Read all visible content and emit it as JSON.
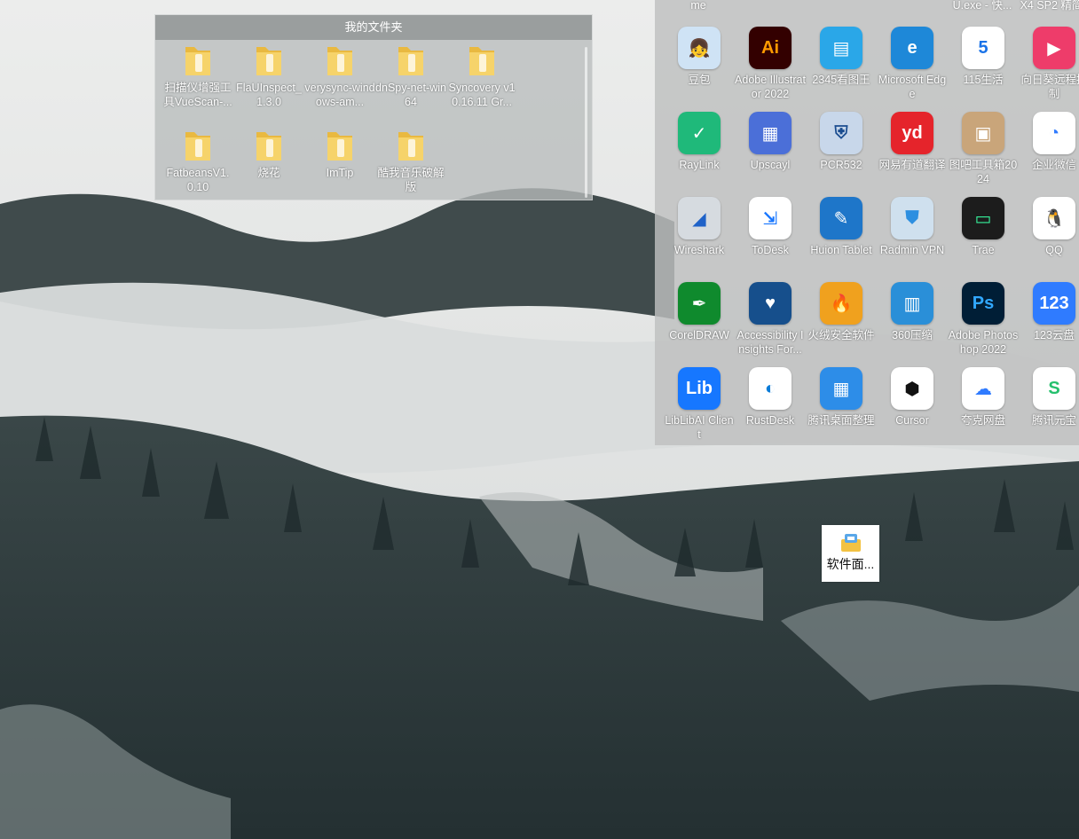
{
  "folder_window": {
    "title": "我的文件夹",
    "items": [
      {
        "label": "扫描仪增强工具VueScan-...",
        "icon": "folder-icon"
      },
      {
        "label": "FlaUInspect_1.3.0",
        "icon": "folder-icon"
      },
      {
        "label": "verysync-windows-am...",
        "icon": "folder-icon"
      },
      {
        "label": "dnSpy-net-win64",
        "icon": "folder-icon"
      },
      {
        "label": "Syncovery v10.16.11 Gr...",
        "icon": "folder-icon"
      },
      {
        "label": "FatbeansV1.0.10",
        "icon": "folder-icon"
      },
      {
        "label": "烧花",
        "icon": "folder-icon"
      },
      {
        "label": "ImTip",
        "icon": "folder-icon"
      },
      {
        "label": "酷我音乐破解版",
        "icon": "folder-icon"
      }
    ]
  },
  "apps_panel": {
    "top_partial_labels": [
      "me",
      "U.exe - 快...",
      "X4 SP2 精简"
    ],
    "apps": [
      {
        "label": "豆包",
        "icon": "doubao-icon",
        "bg": "#cfe3f5",
        "glyph": "👧"
      },
      {
        "label": "Adobe Illustrator 2022",
        "icon": "illustrator-icon",
        "bg": "#330000",
        "glyph": "Ai",
        "fg": "#ff9a00"
      },
      {
        "label": "2345看图王",
        "icon": "2345-viewer-icon",
        "bg": "#2aa7e8",
        "glyph": "▤"
      },
      {
        "label": "Microsoft Edge",
        "icon": "edge-icon",
        "bg": "#1e88d8",
        "glyph": "e"
      },
      {
        "label": "115生活",
        "icon": "115-icon",
        "bg": "#ffffff",
        "glyph": "5",
        "fg": "#1a73e8"
      },
      {
        "label": "向日葵远程控制",
        "icon": "sunlogin-icon",
        "bg": "#ee3c6a",
        "glyph": "▶"
      },
      {
        "label": "RayLink",
        "icon": "raylink-icon",
        "bg": "#1fb97a",
        "glyph": "✓"
      },
      {
        "label": "Upscayl",
        "icon": "upscayl-icon",
        "bg": "#4b6fd8",
        "glyph": "▦"
      },
      {
        "label": "PCR532",
        "icon": "pcr532-icon",
        "bg": "#c8d7ea",
        "glyph": "⛨",
        "fg": "#1a4c8f"
      },
      {
        "label": "网易有道翻译",
        "icon": "youdao-icon",
        "bg": "#e5242b",
        "glyph": "yd"
      },
      {
        "label": "图吧工具箱2024",
        "icon": "tuba-icon",
        "bg": "#c9a57a",
        "glyph": "▣"
      },
      {
        "label": "企业微信",
        "icon": "wecom-icon",
        "bg": "#ffffff",
        "glyph": "◔",
        "fg": "#2f7bff"
      },
      {
        "label": "Wireshark",
        "icon": "wireshark-icon",
        "bg": "#d6dbe0",
        "glyph": "◢",
        "fg": "#1f62c8"
      },
      {
        "label": "ToDesk",
        "icon": "todesk-icon",
        "bg": "#ffffff",
        "glyph": "⇲",
        "fg": "#1977ff"
      },
      {
        "label": "Huion Tablet",
        "icon": "huion-icon",
        "bg": "#1e76c9",
        "glyph": "✎"
      },
      {
        "label": "Radmin VPN",
        "icon": "radmin-icon",
        "bg": "#cfe0ee",
        "glyph": "⛊",
        "fg": "#2d8fe0"
      },
      {
        "label": "Trae",
        "icon": "trae-icon",
        "bg": "#1c1c1c",
        "glyph": "▭",
        "fg": "#36f09a"
      },
      {
        "label": "QQ",
        "icon": "qq-icon",
        "bg": "#ffffff",
        "glyph": "🐧"
      },
      {
        "label": "CorelDRAW",
        "icon": "coreldraw-icon",
        "bg": "#0f8a2d",
        "glyph": "✒"
      },
      {
        "label": "Accessibility Insights For...",
        "icon": "accessibility-insights-icon",
        "bg": "#164f8c",
        "glyph": "♥"
      },
      {
        "label": "火绒安全软件",
        "icon": "huorong-icon",
        "bg": "#f0a11e",
        "glyph": "🔥"
      },
      {
        "label": "360压缩",
        "icon": "360zip-icon",
        "bg": "#2a8fd8",
        "glyph": "▥"
      },
      {
        "label": "Adobe Photoshop 2022",
        "icon": "photoshop-icon",
        "bg": "#001e36",
        "glyph": "Ps",
        "fg": "#31a8ff"
      },
      {
        "label": "123云盘",
        "icon": "123pan-icon",
        "bg": "#2f7bff",
        "glyph": "123"
      },
      {
        "label": "LibLibAI Client",
        "icon": "liblibai-icon",
        "bg": "#1677ff",
        "glyph": "Lib"
      },
      {
        "label": "RustDesk",
        "icon": "rustdesk-icon",
        "bg": "#ffffff",
        "glyph": "◐",
        "fg": "#0a7cd8"
      },
      {
        "label": "腾讯桌面整理",
        "icon": "tencent-desktop-icon",
        "bg": "#2d8de8",
        "glyph": "▦"
      },
      {
        "label": "Cursor",
        "icon": "cursor-icon",
        "bg": "#ffffff",
        "glyph": "⬢",
        "fg": "#111"
      },
      {
        "label": "夸克网盘",
        "icon": "quark-pan-icon",
        "bg": "#ffffff",
        "glyph": "☁",
        "fg": "#2f7bff"
      },
      {
        "label": "腾讯元宝",
        "icon": "yuanbao-icon",
        "bg": "#ffffff",
        "glyph": "S",
        "fg": "#25c06d"
      }
    ]
  },
  "desktop_shortcut": {
    "label": "软件面...",
    "icon": "software-panel-icon"
  }
}
